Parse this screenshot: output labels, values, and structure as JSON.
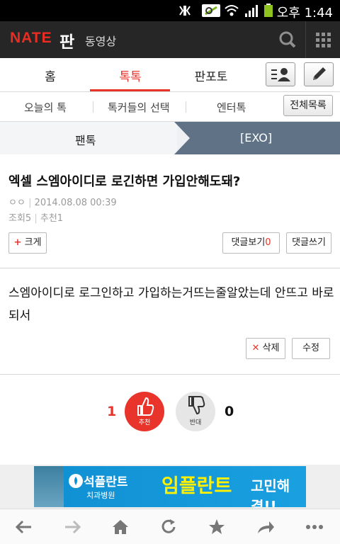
{
  "statusbar": {
    "time": "오후 1:44"
  },
  "appbar": {
    "logo": "NATE",
    "logo_pan": "판",
    "video": "동영상"
  },
  "tabs": [
    {
      "label": "홈"
    },
    {
      "label": "톡톡"
    },
    {
      "label": "판포토"
    }
  ],
  "subnav": {
    "today": "오늘의 톡",
    "picks": "톡커들의 선택",
    "entertainment": "엔터톡",
    "all": "전체목록"
  },
  "breadcrumb": {
    "category": "팬톡",
    "board": "[EXO]"
  },
  "post": {
    "title": "엑셀 스엠아이디로 로긴하면 가입안해도돼?",
    "author": "ㅇㅇ",
    "date": "2014.08.08 00:39",
    "views": "조회5",
    "recommend": "추천1",
    "enlarge": "크게",
    "view_comments": "댓글보기",
    "comment_count": "0",
    "write_comment": "댓글쓰기",
    "body": "스엠아이디로 로그인하고 가입하는거뜨는줄알았는데 안뜨고 바로되서",
    "delete": "삭제",
    "edit": "수정"
  },
  "votes": {
    "up_count": "1",
    "up_label": "추천",
    "down_count": "0",
    "down_label": "반대"
  },
  "ad": {
    "brand": "석플란트",
    "sub": "치과병원",
    "headline": "임플란트",
    "tail": "고민해결!!"
  },
  "colors": {
    "accent": "#e8342b",
    "appbar": "#262626",
    "breadcrumb_active": "#5f7286"
  },
  "icons": [
    "search-icon",
    "grid-icon",
    "list-user-icon",
    "pencil-icon",
    "thumbs-up-icon",
    "thumbs-down-icon",
    "back-icon",
    "forward-icon",
    "home-icon",
    "refresh-icon",
    "star-icon",
    "share-icon",
    "more-icon"
  ]
}
